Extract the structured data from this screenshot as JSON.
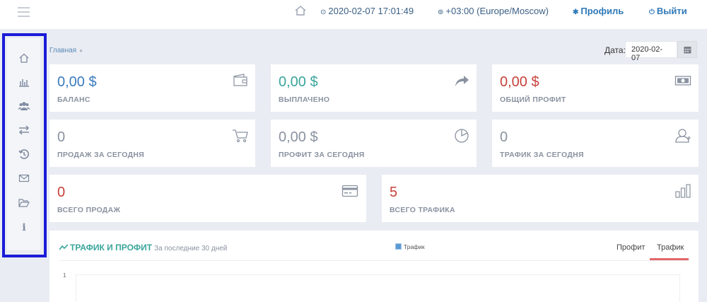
{
  "header": {
    "datetime": "2020-02-07 17:01:49",
    "timezone": "+03:00 (Europe/Moscow)",
    "profile_label": "Профиль",
    "logout_label": "Выйти"
  },
  "sidebar": {
    "items": [
      {
        "icon": "home-icon"
      },
      {
        "icon": "bar-chart-icon"
      },
      {
        "icon": "users-icon"
      },
      {
        "icon": "exchange-icon"
      },
      {
        "icon": "history-icon"
      },
      {
        "icon": "envelope-icon"
      },
      {
        "icon": "folder-open-icon"
      },
      {
        "icon": "info-icon"
      }
    ]
  },
  "breadcrumb": {
    "home": "Главная"
  },
  "date_filter": {
    "label": "Дата:",
    "value": "2020-02-07"
  },
  "cards": {
    "balance": {
      "value": "0,00 $",
      "label": "БАЛАНС",
      "icon": "wallet-icon"
    },
    "paid": {
      "value": "0,00 $",
      "label": "ВЫПЛАЧЕНО",
      "icon": "share-arrow-icon"
    },
    "total_profit": {
      "value": "0,00 $",
      "label": "ОБЩИЙ ПРОФИТ",
      "icon": "money-icon"
    },
    "sales_today": {
      "value": "0",
      "label": "ПРОДАЖ ЗА СЕГОДНЯ",
      "icon": "cart-icon"
    },
    "profit_today": {
      "value": "0,00 $",
      "label": "ПРОФИТ ЗА СЕГОДНЯ",
      "icon": "pie-chart-icon"
    },
    "traffic_today": {
      "value": "0",
      "label": "ТРАФИК ЗА СЕГОДНЯ",
      "icon": "user-outline-icon"
    },
    "total_sales": {
      "value": "0",
      "label": "ВСЕГО ПРОДАЖ",
      "icon": "credit-card-icon"
    },
    "total_traffic": {
      "value": "5",
      "label": "ВСЕГО ТРАФИКА",
      "icon": "bars-icon"
    }
  },
  "chart_panel": {
    "title": "ТРАФИК И ПРОФИТ",
    "subtitle": "За последние 30 дней",
    "legend": "Трафик",
    "tabs": [
      "Профит",
      "Трафик"
    ],
    "active_tab": "Трафик"
  },
  "chart_data": {
    "type": "line",
    "title": "ТРАФИК И ПРОФИТ",
    "subtitle": "За последние 30 дней",
    "series": [
      {
        "name": "Трафик",
        "values": []
      }
    ],
    "y_ticks": [
      "1"
    ],
    "legend_position": "top-center",
    "colors": {
      "Трафик": "#5a9bd4"
    }
  },
  "colors": {
    "accent_blue": "#3a7bbf",
    "accent_green": "#3aa59b",
    "accent_red": "#c9403a",
    "tab_active": "#e2676a"
  }
}
